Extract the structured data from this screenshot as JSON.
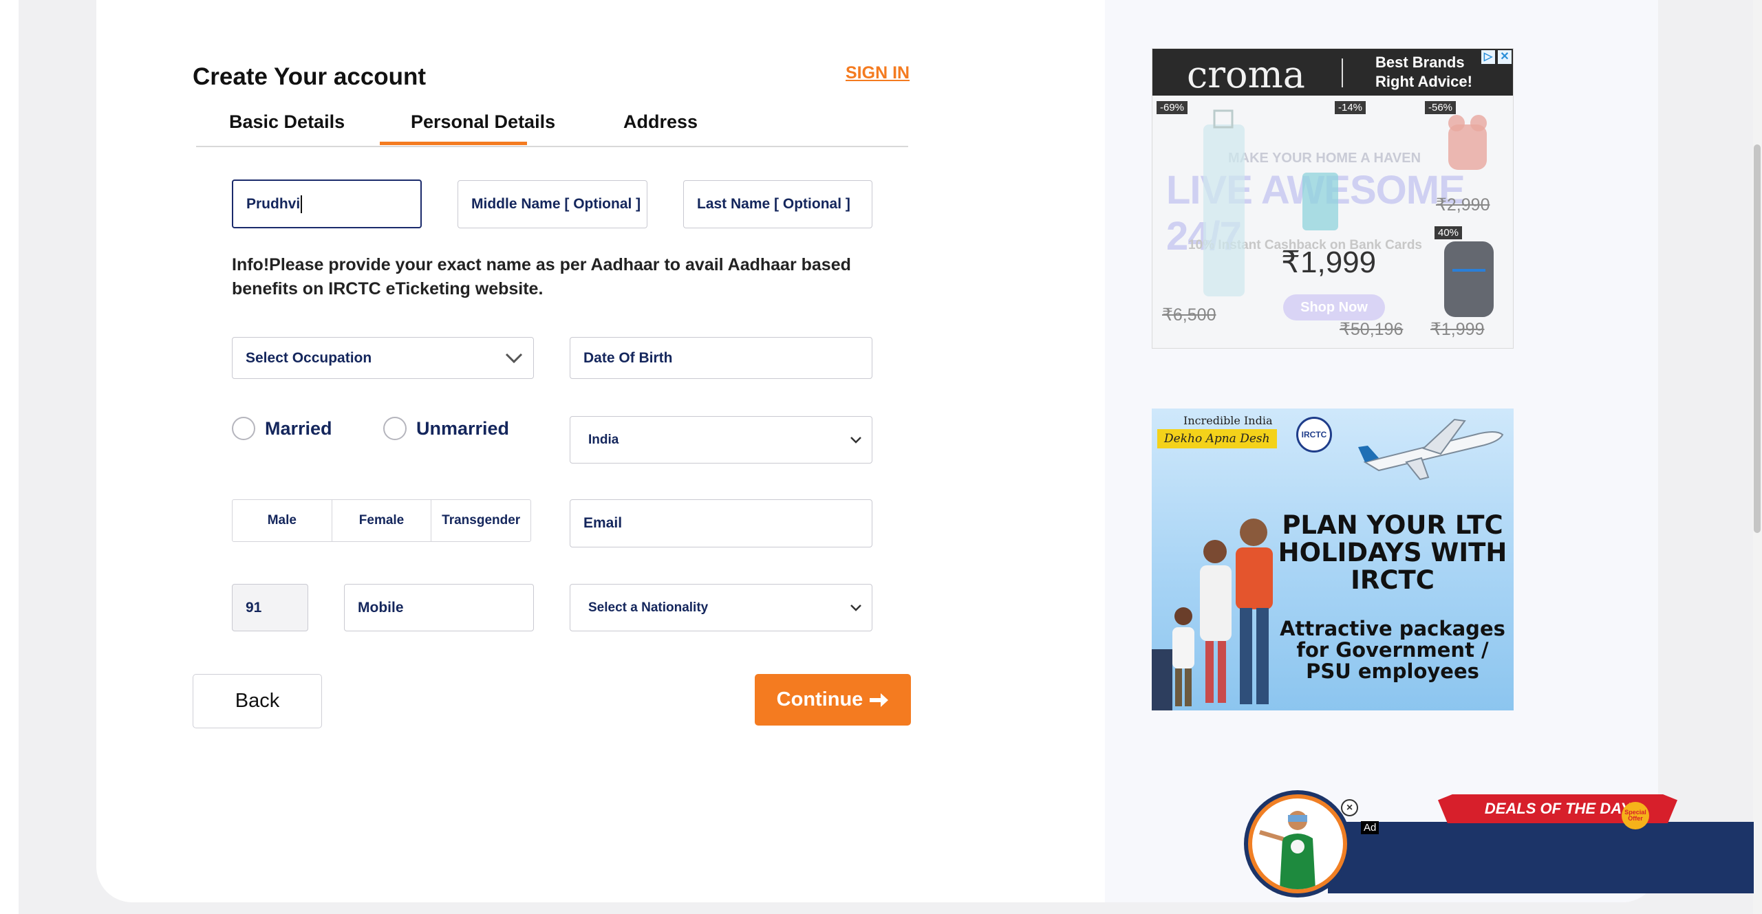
{
  "header": {
    "title": "Create Your account",
    "signin_label": "SIGN IN"
  },
  "tabs": [
    {
      "label": "Basic Details"
    },
    {
      "label": "Personal Details",
      "active": true
    },
    {
      "label": "Address"
    }
  ],
  "form": {
    "first_name_value": "Prudhvi",
    "middle_name_placeholder": "Middle Name  [ Optional ]",
    "last_name_placeholder": "Last Name  [ Optional ]",
    "info_text": "Info!Please provide your exact name as per Aadhaar to avail Aadhaar based benefits on IRCTC eTicketing website.",
    "occupation_placeholder": "Select Occupation",
    "dob_placeholder": "Date Of Birth",
    "marital_options": [
      "Married",
      "Unmarried"
    ],
    "country_value": "India",
    "gender_options": [
      "Male",
      "Female",
      "Transgender"
    ],
    "email_placeholder": "Email",
    "country_code": "91",
    "mobile_placeholder": "Mobile",
    "nationality_placeholder": "Select a Nationality"
  },
  "buttons": {
    "back_label": "Back",
    "continue_label": "Continue"
  },
  "ads": {
    "croma": {
      "logo": "croma",
      "tagline_1": "Best Brands",
      "tagline_2": "Right Advice!",
      "discounts": [
        "-69%",
        "-14%",
        "-56%",
        "40%"
      ],
      "headline": "MAKE YOUR HOME A HAVEN",
      "live_awesome": "LIVE AWESOME 24/7",
      "cashback": "10% Instant Cashback on Bank Cards",
      "price": "₹1,999",
      "strike_prices": [
        "₹6,500",
        "₹50,196",
        "₹1,999",
        "₹2,990"
      ],
      "shop_now": "Shop Now"
    },
    "irctc": {
      "incredible": "Incredible India",
      "dekho": "Dekho Apna Desh",
      "logo_text": "IRCTC",
      "headline": "PLAN YOUR LTC HOLIDAYS WITH IRCTC",
      "sub": "Attractive packages for Government / PSU employees"
    },
    "deals": {
      "ribbon": "DEALS OF THE DAY",
      "special": "Special Offer",
      "ad_tag": "Ad"
    }
  },
  "colors": {
    "accent": "#f47b20",
    "navy": "#14265c",
    "deals_bar": "#1c3468"
  }
}
